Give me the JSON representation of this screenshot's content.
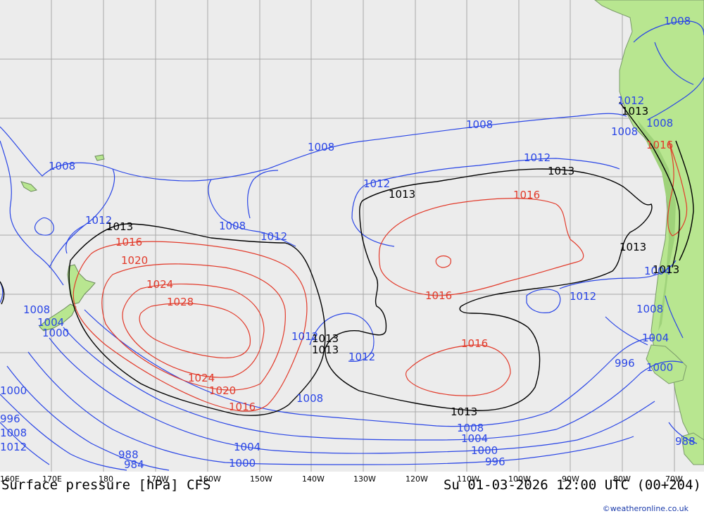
{
  "map": {
    "isobar_labels": {
      "blue": [
        "1008",
        "1008",
        "1008",
        "1008",
        "1008",
        "1012",
        "1012",
        "1012",
        "1012",
        "1012",
        "1012",
        "1008",
        "1004",
        "1000",
        "1008",
        "1012",
        "1008",
        "1008",
        "1004",
        "1000",
        "996",
        "1008",
        "1004",
        "1000",
        "996",
        "988",
        "984",
        "988",
        "1004",
        "1000",
        "1008",
        "1004",
        "1000",
        "996",
        "1008",
        "1012",
        "1012"
      ],
      "red": [
        "1016",
        "1020",
        "1024",
        "1028",
        "1024",
        "1020",
        "1016",
        "1016",
        "1016",
        "1016",
        "1016"
      ],
      "black": [
        "1013",
        "1013",
        "1013",
        "1013",
        "1013",
        "1013",
        "1013",
        "1013",
        "1013"
      ]
    },
    "longitude_ticks": [
      "160E",
      "170E",
      "180",
      "170W",
      "160W",
      "150W",
      "140W",
      "130W",
      "120W",
      "110W",
      "100W",
      "90W",
      "80W",
      "70W"
    ]
  },
  "footer": {
    "title": "Surface pressure [hPa] CFS",
    "datetime": "Su 01-03-2026 12:00 UTC (00+204)",
    "credit": "©weatheronline.co.uk"
  },
  "colors": {
    "ocean": "#ececec",
    "land": "#b8e690",
    "grid": "#a8a8a8",
    "isobar_low": "#2a46e6",
    "isobar_high": "#e23a2a",
    "isobar_1013": "#000000"
  }
}
